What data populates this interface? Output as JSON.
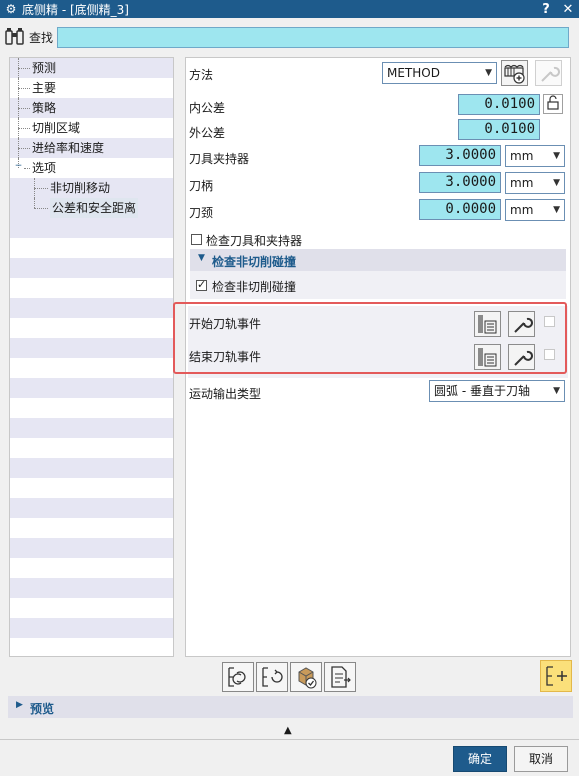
{
  "window": {
    "title": "底侧精 - [底侧精_3]",
    "help_label": "?",
    "close_label": "✕"
  },
  "find": {
    "label": "查找",
    "value": ""
  },
  "nav": {
    "items": [
      {
        "label": "预测"
      },
      {
        "label": "主要"
      },
      {
        "label": "策略"
      },
      {
        "label": "切削区域"
      },
      {
        "label": "进给率和速度"
      },
      {
        "label": "选项",
        "expander": "−"
      },
      {
        "label": "非切削移动"
      },
      {
        "label": "公差和安全距离"
      }
    ]
  },
  "form": {
    "method_label": "方法",
    "method_value": "METHOD",
    "intol_label": "内公差",
    "intol_value": "0.0100",
    "outtol_label": "外公差",
    "outtol_value": "0.0100",
    "holder_label": "刀具夹持器",
    "holder_value": "3.0000",
    "holder_unit": "mm",
    "shank_label": "刀柄",
    "shank_value": "3.0000",
    "shank_unit": "mm",
    "neck_label": "刀颈",
    "neck_value": "0.0000",
    "neck_unit": "mm",
    "check_holder_label": "检查刀具和夹持器",
    "group_title": "检查非切削碰撞",
    "check_noncut_label": "检查非切削碰撞",
    "start_event_label": "开始刀轨事件",
    "end_event_label": "结束刀轨事件",
    "motion_type_label": "运动输出类型",
    "motion_type_value": "圆弧 - 垂直于刀轴"
  },
  "preview": {
    "title": "预览"
  },
  "buttons": {
    "ok": "确定",
    "cancel": "取消"
  },
  "colors": {
    "title_bar": "#1e5b8c",
    "input_fill": "#9ee6ef",
    "highlight": "#e35a5a",
    "add_button": "#fbe07a"
  }
}
